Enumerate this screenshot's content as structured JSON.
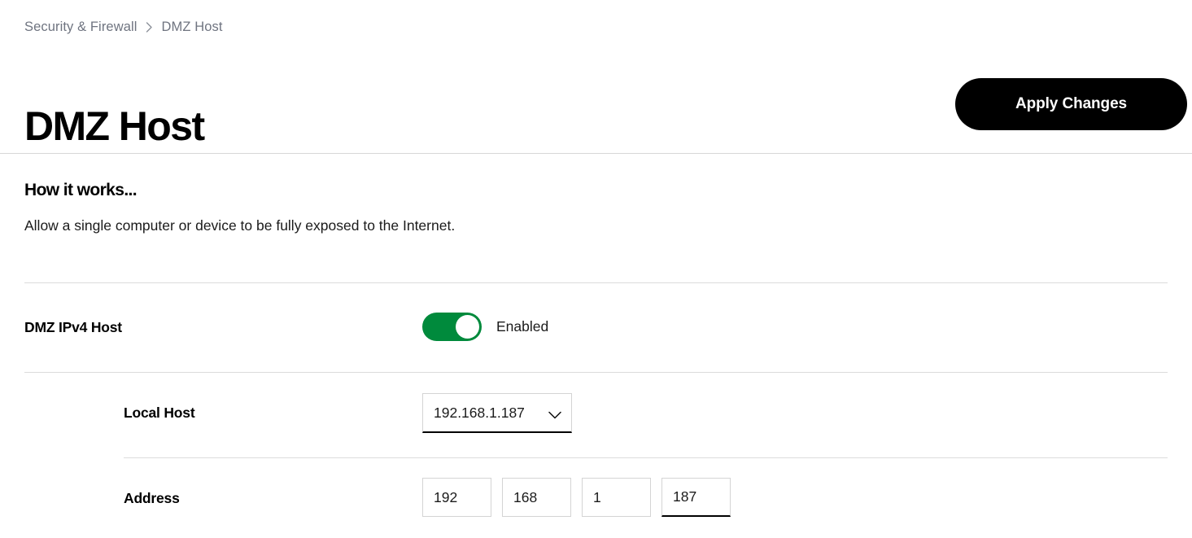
{
  "breadcrumb": {
    "parent": "Security & Firewall",
    "separator_icon": "chevron-right-icon",
    "separator": "›",
    "current": "DMZ Host"
  },
  "header": {
    "title": "DMZ Host",
    "apply_label": "Apply Changes"
  },
  "how_it_works": {
    "title": "How it works...",
    "body": "Allow a single computer or device to be fully exposed to the Internet."
  },
  "dmz_row": {
    "label": "DMZ IPv4 Host",
    "toggle_state_label": "Enabled",
    "toggle_on": true,
    "toggle_on_color": "#008a3c"
  },
  "local_host_row": {
    "label": "Local Host",
    "selected_value": "192.168.1.187",
    "chevron_icon": "chevron-down-icon",
    "options": [
      "192.168.1.187"
    ]
  },
  "address_row": {
    "label": "Address",
    "octets": [
      {
        "value": "192",
        "active": false
      },
      {
        "value": "168",
        "active": false
      },
      {
        "value": "1",
        "active": false
      },
      {
        "value": "187",
        "active": true
      }
    ]
  }
}
